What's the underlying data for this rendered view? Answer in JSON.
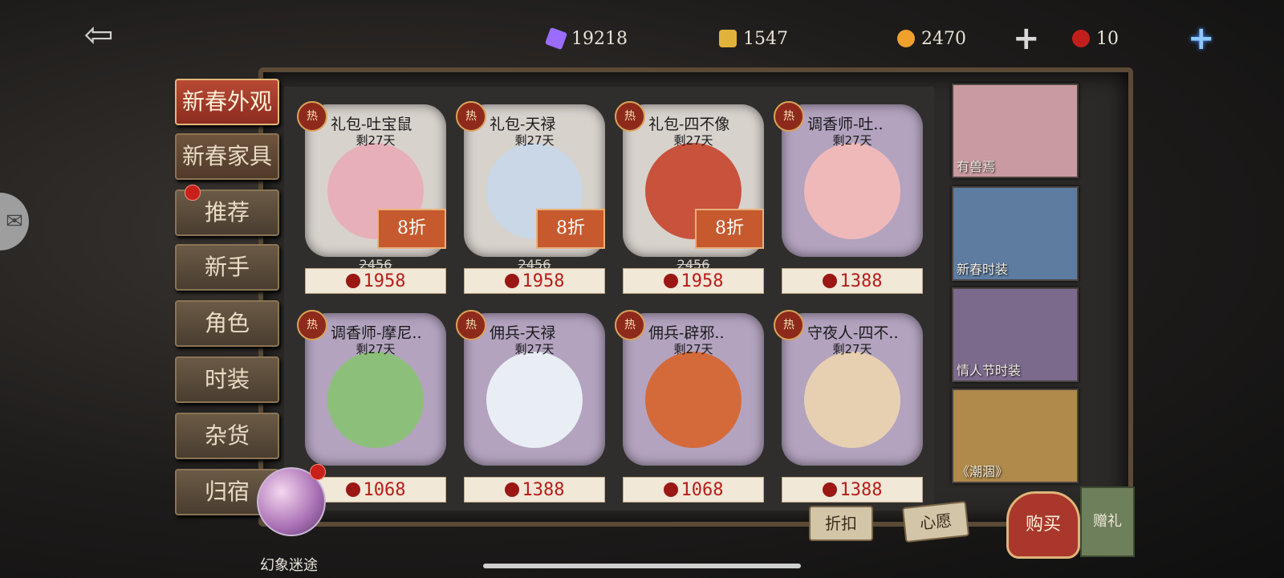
{
  "currencies": [
    {
      "name": "purple-gem",
      "value": "19218",
      "color": "#9a6cff"
    },
    {
      "name": "puzzle",
      "value": "1547",
      "color": "#e2b33b"
    },
    {
      "name": "clue-coin",
      "value": "2470",
      "color": "#f0a12c"
    },
    {
      "name": "red-seal",
      "value": "10",
      "color": "#c0201b"
    }
  ],
  "plus_symbol": "+",
  "menu": [
    {
      "label": "新春外观",
      "active": true
    },
    {
      "label": "新春家具"
    },
    {
      "label": "推荐",
      "badge": true
    },
    {
      "label": "新手"
    },
    {
      "label": "角色"
    },
    {
      "label": "时装"
    },
    {
      "label": "杂货"
    },
    {
      "label": "归宿"
    }
  ],
  "hot_label": "热",
  "items": [
    {
      "title": "礼包-吐宝鼠",
      "days": "剩27天",
      "discount": "8折",
      "original": "2456",
      "price": "1958",
      "thumb": "light",
      "art": "#e7b0b9"
    },
    {
      "title": "礼包-天禄",
      "days": "剩27天",
      "discount": "8折",
      "original": "2456",
      "price": "1958",
      "thumb": "light",
      "art": "#c9d7e6"
    },
    {
      "title": "礼包-四不像",
      "days": "剩27天",
      "discount": "8折",
      "original": "2456",
      "price": "1958",
      "thumb": "light",
      "art": "#c8523c"
    },
    {
      "title": "调香师-吐..",
      "days": "剩27天",
      "price": "1388",
      "thumb": "purple",
      "art": "#f0b9b9"
    },
    {
      "title": "调香师-摩尼..",
      "days": "剩27天",
      "price": "1068",
      "thumb": "purple",
      "art": "#8cc07a"
    },
    {
      "title": "佣兵-天禄",
      "days": "剩27天",
      "price": "1388",
      "thumb": "purple",
      "art": "#e9eef4"
    },
    {
      "title": "佣兵-辟邪..",
      "days": "剩27天",
      "price": "1068",
      "thumb": "purple",
      "art": "#d46a3a"
    },
    {
      "title": "守夜人-四不..",
      "days": "剩27天",
      "price": "1388",
      "thumb": "purple",
      "art": "#e7d0b1"
    }
  ],
  "banners": [
    {
      "label": "有兽焉",
      "color": "#c99aa0"
    },
    {
      "label": "新春时装",
      "color": "#5d7ca0"
    },
    {
      "label": "情人节时装",
      "color": "#7b6a8c"
    },
    {
      "label": "《潮涸》",
      "color": "#b08a4a"
    }
  ],
  "bottom": {
    "discount_label": "折扣",
    "wish_label": "心愿",
    "buy_label": "购买",
    "gift_label": "赠礼",
    "orb_label": "幻象迷途"
  }
}
